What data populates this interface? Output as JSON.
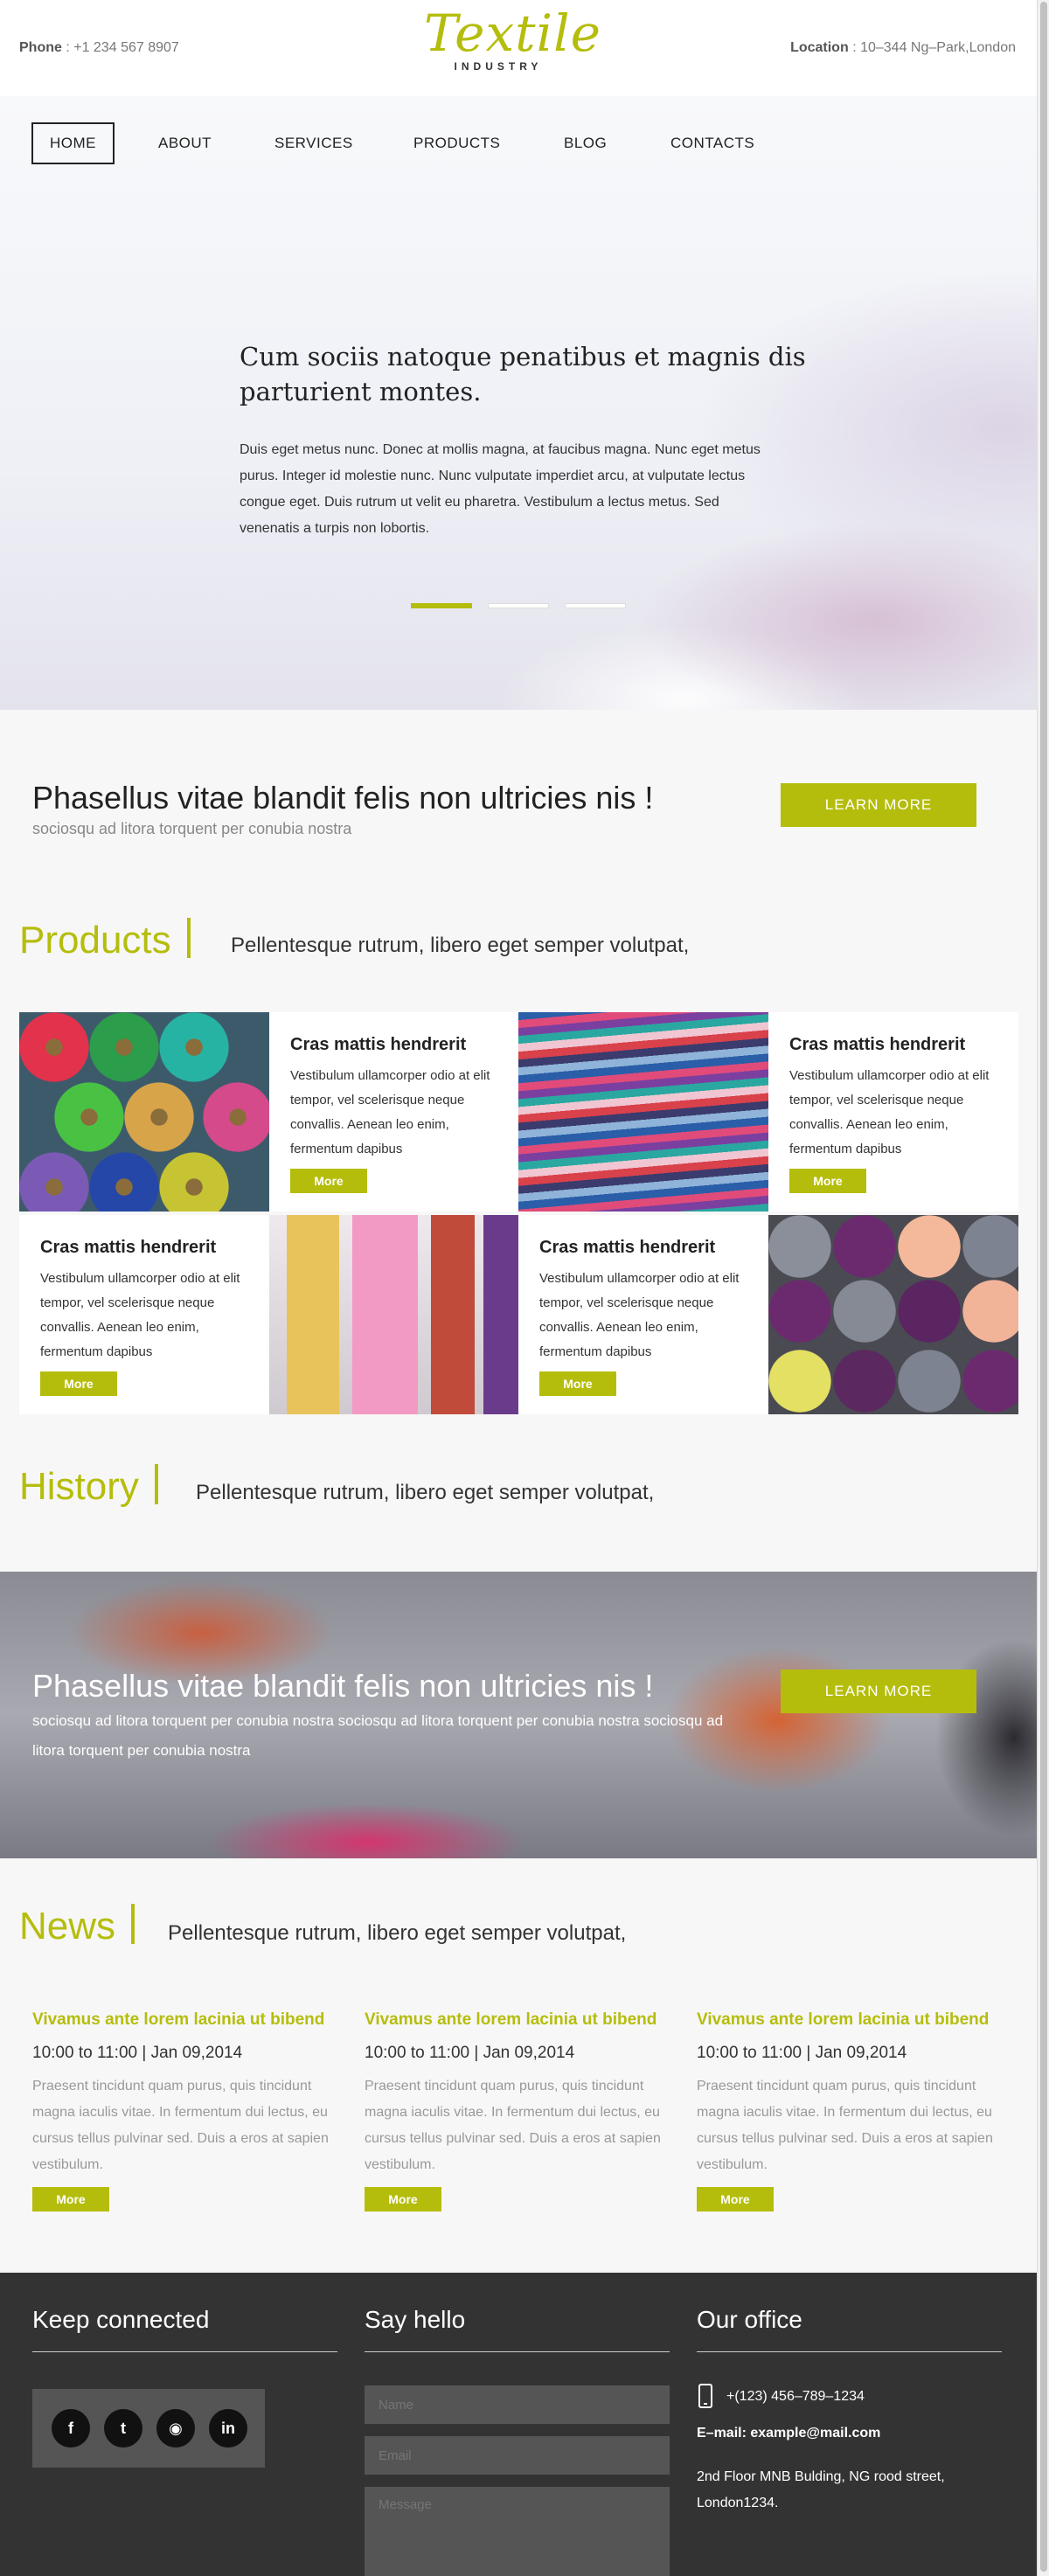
{
  "header": {
    "phone_label": "Phone",
    "phone_value": ": +1 234 567 8907",
    "logo_text": "Textile",
    "logo_sub": "INDUSTRY",
    "location_label": "Location",
    "location_value": ": 10–344 Ng–Park,London"
  },
  "nav": [
    {
      "label": "HOME"
    },
    {
      "label": "ABOUT"
    },
    {
      "label": "SERVICES"
    },
    {
      "label": "PRODUCTS"
    },
    {
      "label": "BLOG"
    },
    {
      "label": "CONTACTS"
    }
  ],
  "hero": {
    "heading": "Cum sociis natoque penatibus et magnis dis parturient montes.",
    "body": "Duis eget metus nunc. Donec at mollis magna, at faucibus magna. Nunc eget metus purus. Integer id molestie nunc. Nunc vulputate imperdiet arcu, at vulputate lectus congue eget. Duis rutrum ut velit eu pharetra. Vestibulum a lectus metus. Sed venenatis a turpis non lobortis.",
    "slides": 3,
    "active_slide": 1
  },
  "cta1": {
    "heading": "Phasellus vitae blandit felis non ultricies nis !",
    "sub": "sociosqu ad litora torquent per conubia nostra",
    "button": "LEARN MORE"
  },
  "products": {
    "title": "Products",
    "subtitle": "Pellentesque rutrum, libero eget semper volutpat,",
    "card": {
      "title": "Cras mattis hendrerit",
      "text": "Vestibulum ullamcorper odio at elit tempor, vel scelerisque neque convallis. Aenean leo enim, fermentum dapibus",
      "button": "More"
    }
  },
  "history": {
    "title": "History",
    "subtitle": "Pellentesque rutrum, libero eget semper volutpat,"
  },
  "cta2": {
    "heading": "Phasellus vitae blandit felis non ultricies nis !",
    "desc": "sociosqu ad litora torquent per conubia nostra sociosqu ad litora torquent per conubia nostra sociosqu ad litora torquent per conubia nostra",
    "button": "LEARN MORE"
  },
  "news": {
    "title": "News",
    "subtitle": "Pellentesque rutrum, libero eget semper volutpat,",
    "items": [
      {
        "title": "Vivamus ante lorem lacinia ut bibend",
        "date": "10:00 to 11:00 | Jan 09,2014",
        "text": "Praesent tincidunt quam purus, quis tincidunt magna iaculis vitae. In fermentum dui lectus, eu cursus tellus pulvinar sed. Duis a eros at sapien vestibulum.",
        "button": "More"
      },
      {
        "title": "Vivamus ante lorem lacinia ut bibend",
        "date": "10:00 to 11:00 | Jan 09,2014",
        "text": "Praesent tincidunt quam purus, quis tincidunt magna iaculis vitae. In fermentum dui lectus, eu cursus tellus pulvinar sed. Duis a eros at sapien vestibulum.",
        "button": "More"
      },
      {
        "title": "Vivamus ante lorem lacinia ut bibend",
        "date": "10:00 to 11:00 | Jan 09,2014",
        "text": "Praesent tincidunt quam purus, quis tincidunt magna iaculis vitae. In fermentum dui lectus, eu cursus tellus pulvinar sed. Duis a eros at sapien vestibulum.",
        "button": "More"
      }
    ]
  },
  "footer": {
    "keep_connected": "Keep connected",
    "social_icons": [
      "facebook-icon",
      "twitter-icon",
      "rss-icon",
      "linkedin-icon"
    ],
    "say_hello": "Say hello",
    "name_placeholder": "Name",
    "email_placeholder": "Email",
    "message_placeholder": "Message",
    "our_office": "Our office",
    "phone": "+(123) 456–789–1234",
    "email": "E–mail: example@mail.com",
    "address": "2nd Floor MNB Bulding, NG rood street, London1234."
  },
  "colors": {
    "accent": "#b5bd0c",
    "footer_bg": "#333333",
    "input_bg": "#555555"
  }
}
